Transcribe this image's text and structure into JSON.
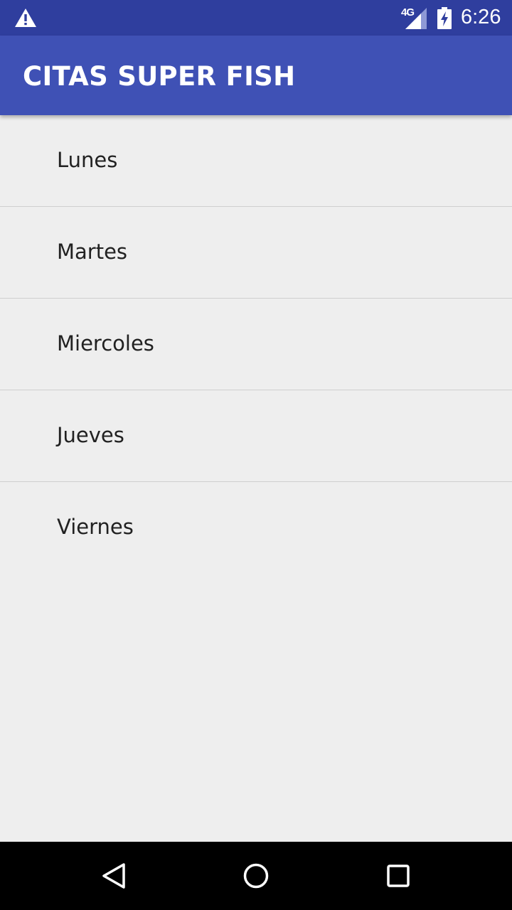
{
  "status_bar": {
    "network_type": "4G",
    "time": "6:26",
    "icons": [
      "warning-icon",
      "signal-icon",
      "battery-charging-icon"
    ]
  },
  "app_bar": {
    "title": "CITAS SUPER FISH"
  },
  "days": [
    {
      "label": "Lunes"
    },
    {
      "label": "Martes"
    },
    {
      "label": "Miercoles"
    },
    {
      "label": "Jueves"
    },
    {
      "label": "Viernes"
    }
  ],
  "nav_bar": {
    "icons": [
      "back-icon",
      "home-icon",
      "recent-apps-icon"
    ]
  },
  "colors": {
    "status_bar": "#2f3e9e",
    "app_bar": "#3f51b5",
    "background": "#eeeeee",
    "text": "#212121"
  }
}
